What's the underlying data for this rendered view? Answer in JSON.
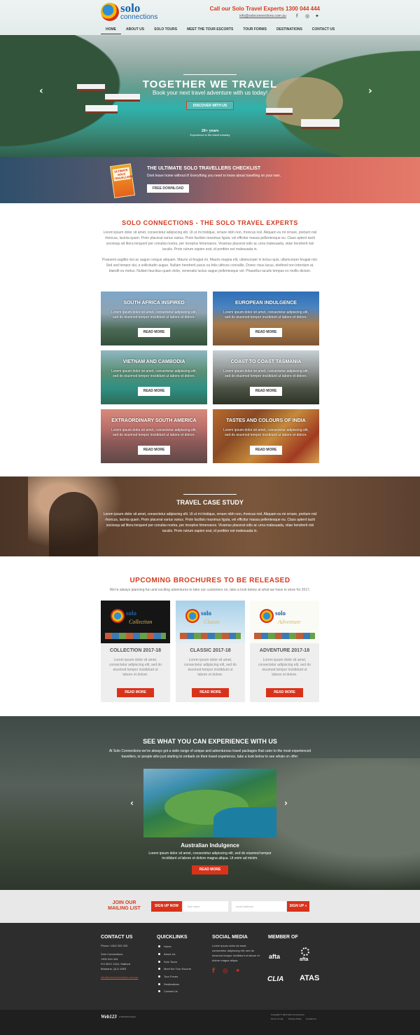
{
  "brand": {
    "name": "solo",
    "name2": "connections",
    "phone_line": "Call our Solo Travel Experts 1300 044 444",
    "email": "info@soloconnections.com.au"
  },
  "social_icons": [
    "facebook-icon",
    "instagram-icon",
    "twitter-icon"
  ],
  "nav": [
    "HOME",
    "ABOUT US",
    "SOLO TOURS",
    "MEET THE TOUR ESCORTS",
    "TOUR FORMS",
    "DESTINATIONS",
    "CONTACT US"
  ],
  "hero": {
    "title": "TOGETHER WE TRAVEL",
    "subtitle": "Book your next travel adventure with us today!",
    "button": "DISCOVER WITH US",
    "award_big": "20+ years",
    "award_small": "Experience in the travel industry"
  },
  "checklist": {
    "book": "ULTIMATE SOLO TRAVELLERS",
    "title": "THE ULTIMATE SOLO TRAVELLERS CHECKLIST",
    "subtitle": "Dont leave home without it! Everything you need to know about travelling on your own.",
    "button": "FREE DOWNLOAD"
  },
  "intro": {
    "title": "SOLO CONNECTIONS - THE SOLO TRAVEL EXPERTS",
    "p1": "Lorem ipsum dolor sit amet, consectetur adipiscing elit. Ut ut mi tristique, ornare nibh non, rhoncus nisl. Aliquam eu mi ornare, pretium nisl rhoncus, lacinia quam. Proin placerat varius varius. Proin facilisis maximus ligula, vel efficitur massa pellentesque eu. Class aptent taciti sociosqu ad litora torquent per conubia nostra, per inceptos himenaeos. Vivamus placerat odio ac urna malesuada, vitae hendrerit nisl iaculis. Proin rutrum sapien erat, id porttitor est malesuada in.",
    "p2": "Praesent sagittis nisi ac augue congue aliquam. Mauris ut feugiat mi. Mauris magna elit, ullamcorper in lectus quis, ullamcorper feugiat nisl. Sed sed tempor dui, a sollicitudin augue. Nullam hendrerit purus eu felis ultrices convallis. Donec risus lacus, eleifend non interdum at, blandit eu metus. Nullam faucibus quam dolor, venenatis luctus augue pellentesque vel. Phasellus iaculis tempus ex mollis dictum."
  },
  "tours": [
    {
      "title": "SOUTH AFRICA INSPIRED",
      "desc": "Lorem ipsum dolor sit amet, consectetur adipiscing elit, sed do eiusmod tempor incididunt ut labore et dolore.",
      "button": "READ MORE"
    },
    {
      "title": "EUROPEAN INDULGENCE",
      "desc": "Lorem ipsum dolor sit amet, consectetur adipiscing elit, sed do eiusmod tempor incididunt ut labore et dolore.",
      "button": "READ MORE"
    },
    {
      "title": "VIETNAM AND CAMBODIA",
      "desc": "Lorem ipsum dolor sit amet, consectetur adipiscing elit, sed do eiusmod tempor incididunt ut labore et dolore.",
      "button": "READ MORE"
    },
    {
      "title": "COAST TO COAST TASMANIA",
      "desc": "Lorem ipsum dolor sit amet, consectetur adipiscing elit, sed do eiusmod tempor incididunt ut labore et dolore.",
      "button": "READ MORE"
    },
    {
      "title": "EXTRAORDINARY SOUTH AMERICA",
      "desc": "Lorem ipsum dolor sit amet, consectetur adipiscing elit, sed do eiusmod tempor incididunt ut labore et dolore.",
      "button": "READ MORE"
    },
    {
      "title": "TASTES AND COLOURS OF INDIA",
      "desc": "Lorem ipsum dolor sit amet, consectetur adipiscing elit, sed do eiusmod tempor incididunt ut labore et dolore.",
      "button": "READ MORE"
    }
  ],
  "case_study": {
    "title": "TRAVEL CASE STUDY",
    "text": "Lorem ipsum dolor sit amet, consectetur adipiscing elit. Ut ut mi tristique, ornare nibh non, rhoncus nisl. Aliquam eu mi ornare, pretium nisl rhoncus, lacinia quam. Proin placerat varius varius. Proin facilisis maximus ligula, vel efficitur massa pellentesque eu. Class aptent taciti sociosqu ad litora torquent per conubia nostra, per inceptos himenaeos. Vivamus placerat odio ac urna malesuada, vitae hendrerit nisl iaculis. Proin rutrum sapien erat, id porttitor est malesuada in."
  },
  "brochures": {
    "title": "UPCOMING BROCHURES TO BE RELEASED",
    "subtitle": "We're always planning fun and exciting adventures to take our customers on, take a look below at what we have in store for 2017.",
    "items": [
      {
        "title": "COLLECTION 2017-18",
        "cover": "Collection",
        "desc": "Lorem ipsum dolor sit amet, consectetur adipiscing elit, sed do eiusmod tempor incididunt ut labore et dolore.",
        "button": "READ MORE"
      },
      {
        "title": "CLASSIC 2017-18",
        "cover": "Classic",
        "desc": "Lorem ipsum dolor sit amet, consectetur adipiscing elit, sed do eiusmod tempor incididunt ut labore et dolore.",
        "button": "READ MORE"
      },
      {
        "title": "ADVENTURE 2017-18",
        "cover": "Adventure",
        "desc": "Lorem ipsum dolor sit amet, consectetur adipiscing elit, sed do eiusmod tempor incididunt ut labore et dolore.",
        "button": "READ MORE"
      }
    ]
  },
  "experience": {
    "title": "SEE WHAT YOU CAN EXPERIENCE WITH US",
    "text": "At Solo Connections we've always got a wide range of unique and adventurous travel packages that cater to the most experienced travellers, or people who just starting to embark on their travel experience, take a look below to see whats on offer:",
    "slide_title": "Australian Indulgence",
    "slide_desc": "Lorem ipsum dolor sit amet, consectetur adipiscing elit, sed do eiusmod tempor incididunt ut labore et dolore magna aliqua. Ut enim ad minim.",
    "button": "READ MORE"
  },
  "mailing": {
    "title": "JOIN OUR MAILING LIST",
    "signup": "SIGN UP NOW",
    "first_name_placeholder": "first name",
    "email_placeholder": "email address",
    "submit": "SIGN UP »"
  },
  "footer": {
    "contact_title": "CONTACT US",
    "contact_lines": [
      "Phone: 1300 333 333",
      "",
      "Solo Connections",
      "1300 044 444",
      "P.O BOX 1344, Stafford",
      "Brisbane, QLD 4053",
      "",
      "info@soloconnections.com.au"
    ],
    "quicklinks_title": "QUICKLINKS",
    "quicklinks": [
      "Home",
      "About Us",
      "Solo Tours",
      "Meet the Tour Escorts",
      "Tour Forms",
      "Destinations",
      "Contact Us"
    ],
    "social_title": "SOCIAL MEDIA",
    "social_text": "Lorem ipsum dolor sit amet, consectetur adipiscing elit, sed do eiusmod tempor incididunt ut labore et dolore magna aliqua.",
    "member_title": "MEMBER OF",
    "members": [
      "afta",
      "afta",
      "CLIA",
      "ATAS"
    ]
  },
  "bottom": {
    "logo": "Web123",
    "project": "A Web123 Project",
    "copyright": "Copyright © 2016 Solo Connections",
    "terms": "Terms of Use",
    "privacy": "Privacy Policy",
    "contact": "Contact Us"
  }
}
